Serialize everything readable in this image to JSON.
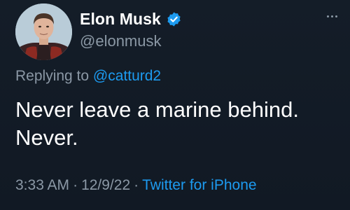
{
  "tweet": {
    "author": {
      "display_name": "Elon Musk",
      "handle": "@elonmusk",
      "verified": true
    },
    "reply": {
      "prefix": "Replying to ",
      "mention": "@catturd2"
    },
    "text_lines": [
      "Never leave a marine behind.",
      "Never."
    ],
    "meta": {
      "time": "3:33 AM",
      "separator": "·",
      "date": "12/9/22",
      "source": "Twitter for iPhone"
    }
  },
  "colors": {
    "background": "#15202b",
    "primary_text": "#ffffff",
    "secondary_text": "#8b98a5",
    "accent": "#1d9bf0"
  },
  "icons": {
    "verified": "verified-badge-icon",
    "more": "more-options-icon"
  }
}
